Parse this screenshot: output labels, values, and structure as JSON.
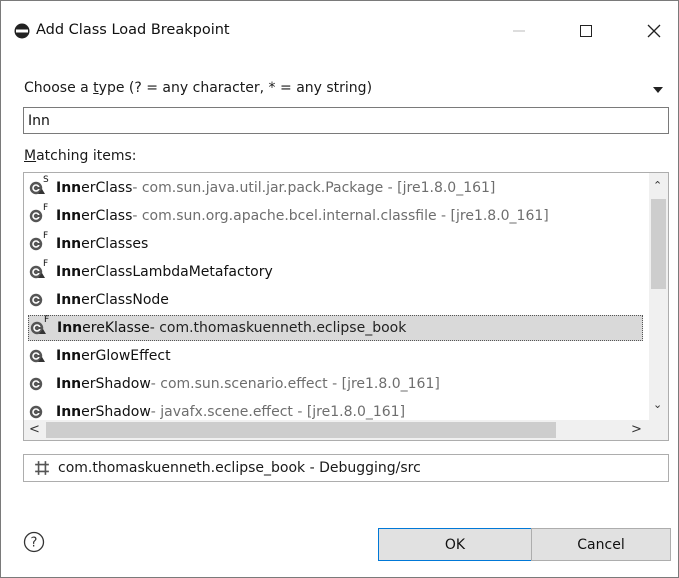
{
  "window": {
    "title": "Add Class Load Breakpoint",
    "icon": "breakpoint-icon"
  },
  "prompt": {
    "label_pre": "Choose a ",
    "label_accel": "t",
    "label_post": "ype (? = any character, * = any string)"
  },
  "search": {
    "value": "Inn"
  },
  "matching": {
    "accel": "M",
    "rest": "atching items:"
  },
  "items": [
    {
      "bold": "Inn",
      "rest": "erClass",
      "qual": " - com.sun.java.util.jar.pack.Package - [jre1.8.0_161]",
      "icon": "class-static-icon",
      "badge": "S"
    },
    {
      "bold": "Inn",
      "rest": "erClass",
      "qual": " - com.sun.org.apache.bcel.internal.classfile - [jre1.8.0_161]",
      "icon": "class-final-icon",
      "badge": "F"
    },
    {
      "bold": "Inn",
      "rest": "erClasses",
      "qual": "",
      "icon": "class-final-icon",
      "badge": "F"
    },
    {
      "bold": "Inn",
      "rest": "erClassLambdaMetafactory",
      "qual": "",
      "icon": "class-abstract-final-icon",
      "badge": "F"
    },
    {
      "bold": "Inn",
      "rest": "erClassNode",
      "qual": "",
      "icon": "class-icon",
      "badge": ""
    },
    {
      "bold": "Inn",
      "rest": "ereKlasse",
      "qual": " - com.thomaskuenneth.eclipse_book",
      "icon": "class-abstract-final-icon",
      "badge": "F"
    },
    {
      "bold": "Inn",
      "rest": "erGlowEffect",
      "qual": "",
      "icon": "class-abstract-icon",
      "badge": ""
    },
    {
      "bold": "Inn",
      "rest": "erShadow",
      "qual": " - com.sun.scenario.effect - [jre1.8.0_161]",
      "icon": "class-icon",
      "badge": ""
    },
    {
      "bold": "Inn",
      "rest": "erShadow",
      "qual": " - javafx.scene.effect - [jre1.8.0_161]",
      "icon": "class-icon",
      "badge": ""
    }
  ],
  "status": {
    "text": "com.thomaskuenneth.eclipse_book - Debugging/src",
    "icon": "package-root-icon"
  },
  "buttons": {
    "ok": "OK",
    "cancel": "Cancel"
  },
  "help": {
    "glyph": "?"
  }
}
